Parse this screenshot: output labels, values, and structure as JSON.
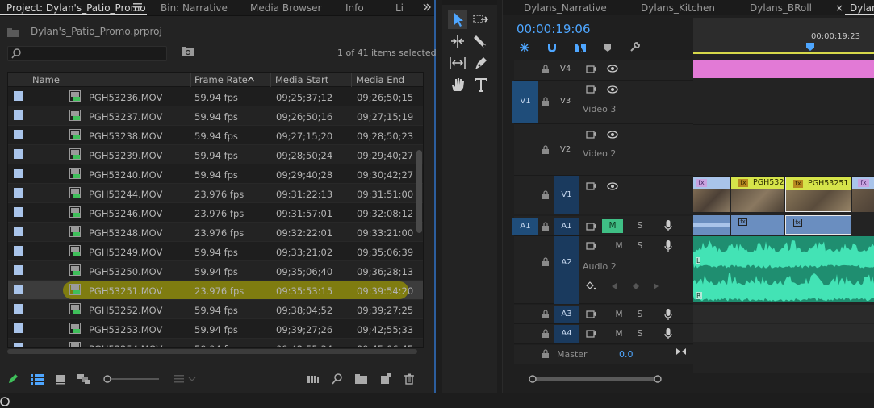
{
  "project_panel": {
    "tabs": [
      "Project: Dylan's_Patio_Promo",
      "Bin: Narrative",
      "Media Browser",
      "Info",
      "Li"
    ],
    "project_file": "Dylan's_Patio_Promo.prproj",
    "selection_status": "1 of 41 items selected",
    "search": {
      "value": "",
      "placeholder": ""
    },
    "columns": [
      "Name",
      "Frame Rate",
      "Media Start",
      "Media End"
    ],
    "rows": [
      {
        "name": "PGH53236.MOV",
        "frame_rate": "59.94 fps",
        "media_start": "09;25;37;12",
        "media_end": "09;26;50;15"
      },
      {
        "name": "PGH53237.MOV",
        "frame_rate": "59.94 fps",
        "media_start": "09;26;50;16",
        "media_end": "09;27;15;19"
      },
      {
        "name": "PGH53238.MOV",
        "frame_rate": "59.94 fps",
        "media_start": "09;27;15;20",
        "media_end": "09;28;50;23"
      },
      {
        "name": "PGH53239.MOV",
        "frame_rate": "59.94 fps",
        "media_start": "09;28;50;24",
        "media_end": "09;29;40;27"
      },
      {
        "name": "PGH53240.MOV",
        "frame_rate": "59.94 fps",
        "media_start": "09;29;40;28",
        "media_end": "09;30;42;27"
      },
      {
        "name": "PGH53244.MOV",
        "frame_rate": "23.976 fps",
        "media_start": "09:31:22:13",
        "media_end": "09:31:51:00"
      },
      {
        "name": "PGH53246.MOV",
        "frame_rate": "23.976 fps",
        "media_start": "09:31:57:01",
        "media_end": "09:32:08:12"
      },
      {
        "name": "PGH53248.MOV",
        "frame_rate": "23.976 fps",
        "media_start": "09:32:22:01",
        "media_end": "09:33:21:00"
      },
      {
        "name": "PGH53249.MOV",
        "frame_rate": "59.94 fps",
        "media_start": "09;33;21;02",
        "media_end": "09;35;06;39"
      },
      {
        "name": "PGH53250.MOV",
        "frame_rate": "59.94 fps",
        "media_start": "09;35;06;40",
        "media_end": "09;36;28;13"
      },
      {
        "name": "PGH53251.MOV",
        "frame_rate": "23.976 fps",
        "media_start": "09:35:53:15",
        "media_end": "09:39:54:20"
      },
      {
        "name": "PGH53252.MOV",
        "frame_rate": "59.94 fps",
        "media_start": "09;38;04;52",
        "media_end": "09;39;27;25"
      },
      {
        "name": "PGH53253.MOV",
        "frame_rate": "59.94 fps",
        "media_start": "09;39;27;26",
        "media_end": "09;42;55;33"
      },
      {
        "name": "PGH53254.MOV",
        "frame_rate": "59.94 fps",
        "media_start": "09;42;55;34",
        "media_end": "09;45;06;45"
      }
    ],
    "highlight_color": "#7f7c10",
    "label_swatch_color": "#a9c4ea"
  },
  "tools_panel": {
    "tools": [
      "selection-tool",
      "track-select-forward-tool",
      "ripple-edit-tool",
      "razor-tool",
      "slip-tool",
      "pen-tool",
      "hand-tool",
      "type-tool"
    ]
  },
  "timeline": {
    "tabs": [
      "Dylans_Narrative",
      "Dylans_Kitchen",
      "Dylans_BRoll",
      "Dylan"
    ],
    "close_glyph": "×",
    "timecode": "00:00:19:06",
    "ruler_time": "00:00:19:23",
    "tracks": {
      "V4": "V4",
      "V3": "V3",
      "V3_name": "Video 3",
      "V2": "V2",
      "V2_name": "Video 2",
      "V1": "V1",
      "A1": "A1",
      "A2": "A2",
      "A2_name": "Audio 2",
      "A3": "A3",
      "A4": "A4",
      "source_V1": "V1",
      "source_A1": "A1",
      "master": "Master",
      "master_value": "0.0"
    },
    "mute_label": "M",
    "solo_label": "S",
    "clips": {
      "v1_clip_a": "PGH532",
      "v1_clip_b": "PGH53251",
      "fx_label": "fx",
      "audio_l": "L",
      "audio_r": "R"
    },
    "colors": {
      "timecode": "#4ea6ff",
      "playhead": "#4ea6ff",
      "pink_clip": "#e27ad6",
      "audio_clip": "#2ec9a0",
      "yellow_clip": "#d6e44a",
      "mute_active": "#3fbf85"
    }
  }
}
